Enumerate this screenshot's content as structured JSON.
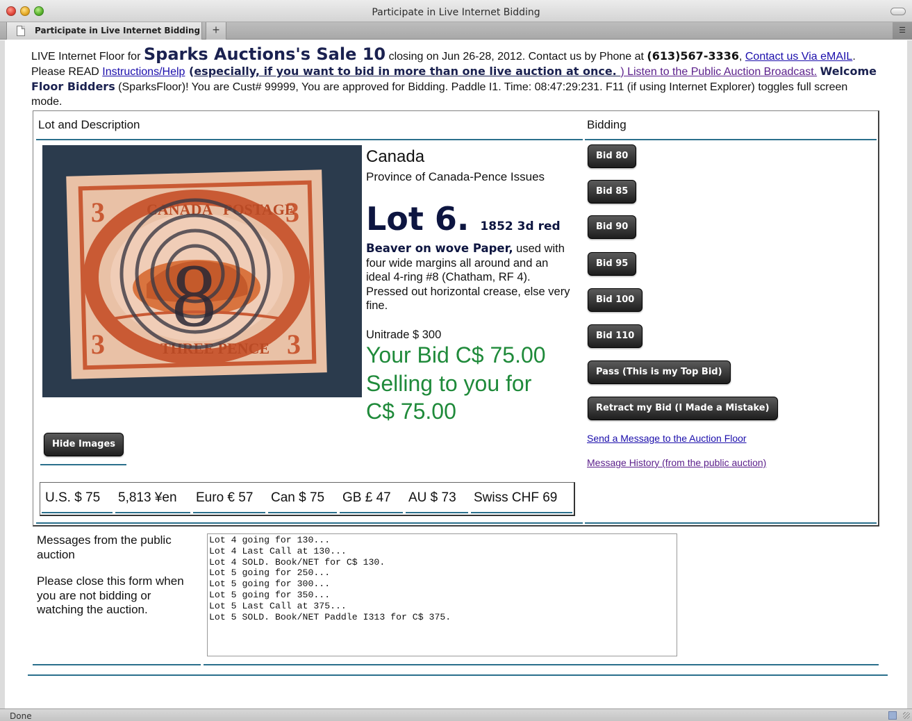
{
  "window": {
    "title": "Participate in Live Internet Bidding"
  },
  "tabs": [
    {
      "label": "Participate in Live Internet Bidding"
    }
  ],
  "tabbar": {
    "new_tab": "+"
  },
  "status": {
    "text": "Done"
  },
  "header": {
    "t1": "LIVE Internet Floor for ",
    "sale": "Sparks Auctions's Sale 10",
    "t2": " closing on Jun 26-28, 2012. Contact us by Phone at ",
    "phone": "(613)567-3336",
    "t3": ", ",
    "contact_link": "Contact us Via eMAIL",
    "t4": ". Please READ ",
    "instructions_link": "Instructions/Help",
    "t5": " (",
    "multi_bid_link": "especially, if you want to bid in more than one live auction at once. ",
    "listen_link": ") Listen to the Public Auction Broadcast.",
    "t6": " ",
    "welcome": "Welcome Floor Bidders",
    "t7": " (SparksFloor)! You are Cust# 99999, You are approved for Bidding. Paddle I1. Time: 08:47:29:231. F11 (if using Internet Explorer) toggles full screen mode."
  },
  "columns": {
    "lot": "Lot and Description",
    "bidding": "Bidding"
  },
  "lot": {
    "country": "Canada",
    "category": "Province of Canada-Pence Issues",
    "number": "Lot 6.",
    "subtitle": "1852 3d red",
    "desc_bold": "Beaver on wove Paper,",
    "desc_rest": " used with four wide margins all around and an ideal 4-ring #8 (Chatham, RF 4). Pressed out horizontal crease, else very fine.",
    "unitrade": "Unitrade $ 300",
    "your_bid": "Your Bid C$ 75.00",
    "selling_line1": "Selling to you for",
    "selling_line2": "C$ 75.00",
    "stamp_text": {
      "left": "CANADA",
      "top": "POSTAGE",
      "bottom": "THREE PENCE",
      "numeral": "3",
      "cancel": "8"
    }
  },
  "buttons": {
    "hide_images": "Hide Images",
    "bids": [
      "Bid 80",
      "Bid 85",
      "Bid 90",
      "Bid 95",
      "Bid 100",
      "Bid 110"
    ],
    "pass": "Pass (This is my Top Bid)",
    "retract": "Retract my Bid (I Made a Mistake)"
  },
  "links": {
    "send_message": "Send a Message to the Auction Floor",
    "message_history": "Message History (from the public auction)"
  },
  "currencies": [
    "U.S. $ 75",
    "5,813 ¥en",
    "Euro € 57",
    "Can $ 75",
    "GB £ 47",
    "AU $ 73",
    "Swiss CHF 69"
  ],
  "messages": {
    "heading": "Messages from the public auction",
    "note": "Please close this form when you are not bidding or watching the auction.",
    "log": "Lot 4 going for 130...\nLot 4 Last Call at 130...\nLot 4 SOLD. Book/NET for C$ 130.\nLot 5 going for 250...\nLot 5 going for 300...\nLot 5 going for 350...\nLot 5 Last Call at 375...\nLot 5 SOLD. Book/NET Paddle I313 for C$ 375."
  },
  "colors": {
    "accent_green": "#1f8a3a",
    "rule_teal": "#2a6f8c",
    "heading_navy": "#1a2150"
  }
}
